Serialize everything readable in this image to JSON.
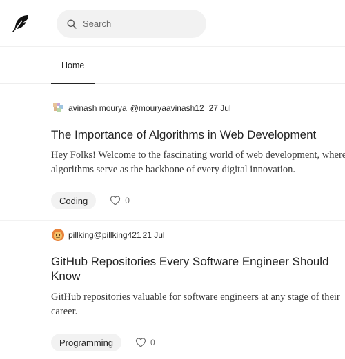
{
  "header": {
    "logo_icon": "feather-icon",
    "search": {
      "placeholder": "Search",
      "value": ""
    }
  },
  "tabs": [
    {
      "label": "Home",
      "active": true
    }
  ],
  "posts": [
    {
      "author_name": "avinash mourya",
      "author_handle": "@mouryaavinash12",
      "date": "27 Jul",
      "title": "The Importance of Algorithms in Web Development",
      "excerpt": "Hey Folks! Welcome to the fascinating world of web development, where algorithms serve as the backbone of every digital innovation.",
      "tag": "Coding",
      "likes": "0"
    },
    {
      "author_name": "pillking",
      "author_handle": "@pillking421",
      "date": "21 Jul",
      "title": "GitHub Repositories Every Software Engineer Should Know",
      "excerpt": "GitHub repositories valuable for software engineers at any stage of their career.",
      "tag": "Programming",
      "likes": "0"
    }
  ],
  "colors": {
    "text": "#242424",
    "muted": "#6b6b6b",
    "chip_bg": "#f2f2f2",
    "divider": "#f2f2f2"
  }
}
